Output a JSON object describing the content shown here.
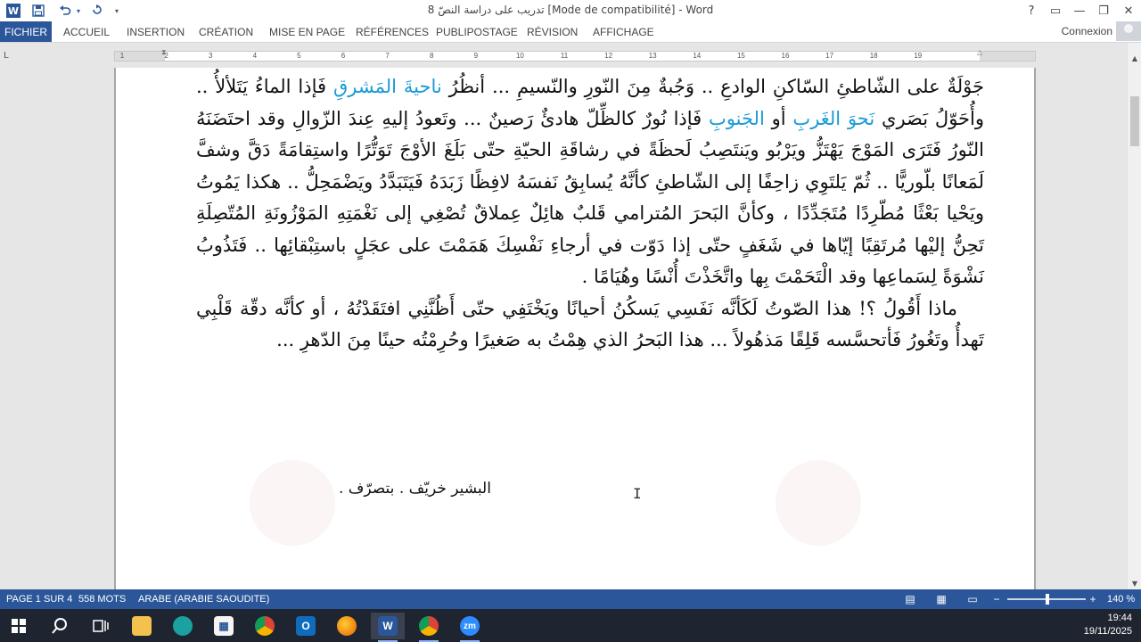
{
  "window": {
    "title": "تدريب على دراسة النصّ 8 [Mode de compatibilité] - Word"
  },
  "quick_access": {
    "word_icon": "W",
    "save_icon": "floppy-disk",
    "undo_icon": "undo-arrow",
    "redo_icon": "redo-arrow",
    "customize_icon": "dropdown-caret"
  },
  "window_controls": {
    "help": "?",
    "ribbon_display": "▭",
    "minimize": "—",
    "restore": "❐",
    "close": "✕"
  },
  "ribbon": {
    "tabs": [
      "FICHIER",
      "ACCUEIL",
      "INSERTION",
      "CRÉATION",
      "MISE EN PAGE",
      "RÉFÉRENCES",
      "PUBLIPOSTAGE",
      "RÉVISION",
      "AFFICHAGE"
    ],
    "account": "Connexion"
  },
  "ruler": {
    "corner": "L",
    "ticks": [
      "1",
      "2",
      "3",
      "4",
      "5",
      "6",
      "7",
      "8",
      "9",
      "10",
      "11",
      "12",
      "13",
      "14",
      "15",
      "16",
      "17",
      "18",
      "19"
    ]
  },
  "document": {
    "paragraphs": [
      [
        {
          "t": "جَوْلَةٌ على الشّاطئِ السّاكنِ الوادعِ .. وَجُبةٌ مِنَ النّورِ والنّسيمِ ... أنظُرُ ",
          "hl": false
        },
        {
          "t": "ناحيةَ المَشرقِ",
          "hl": true
        },
        {
          "t": " فَإذا الماءُ يَتَلألأُ .. وأُحَوّلُ بَصَري ",
          "hl": false
        },
        {
          "t": "نَحوَ الغَربِ",
          "hl": true
        },
        {
          "t": " أو ",
          "hl": false
        },
        {
          "t": "الجَنوبِ",
          "hl": true
        },
        {
          "t": " فَإذا نُورٌ كالظِّلّ هادئٌ رَصينٌ ... وتَعودُ إليهِ عِندَ الزّوالِ وقد احتَضَنَهُ النّورُ فَتَرَى المَوْجَ يَهْتَزُّ ويَرْبُو ويَنتَصِبُ لَحظَةً في رشاقَةِ الحيّةِ حتّى بَلَغَ الأوْجَ تَوَتُّرًا واستِقامَةً دَقَّ وشفَّ لَمَعانًا بلّوريًّا .. ثُمّ يَلتَوِي زاحِفًا إلى الشّاطئِ كأنَّهُ يُسابِقُ نَفسَهُ لافِظًا زَبَدَهُ فَيَتَبَدَّدُ ويَضْمَحِلُّ .. هكذا يَمُوتُ ويَحْيا بَعْثًا مُطّرِدًا مُتَجَدِّدًا ، وكأنَّ البَحرَ المُترامي قَلبٌ هائِلٌ عِملاقٌ تُصْغِي إلى نَغْمَتِهِ المَوْزُونَةِ المُتّصِلَةِ تَحِنُّ إليْها مُرتَقِبًا إيّاها في شَغَفٍ حتّى إذا دَوّت في أرجاءِ نَفْسِكَ هَمَمْتَ على عجَلٍ باستِبْقائِها .. فَتَذُوبُ نَشْوَةً لِسَماعِها وقد الْتَحَمْتَ بِها واتَّخَذْتَ أُنْسًا وهُيَامًا .",
          "hl": false
        }
      ],
      [
        {
          "t": "ماذا أَقُولُ ؟! هذا الصّوتُ لَكَأنَّه نَفَسِي يَسكُنُ أحيانًا ويَخْتَفِي حتّى أَظُنَّنِي افتَقَدْتُهُ ، أو كأنَّه دقّة قَلْبِي تَهدأُ وتَغُورُ فَأتحسَّسه قَلِقًا مَذهُولاً ... هذا البَحرُ الذي هِمْتُ به صَغيرًا وحُرِمْتُه حينًا مِنَ الدّهرِ ...",
          "hl": false
        }
      ]
    ],
    "signature": "البشير خريّف . بتصرّف ."
  },
  "status": {
    "page": "PAGE 1 SUR 4",
    "words": "558 MOTS",
    "language": "ARABE (ARABIE SAOUDITE)",
    "zoom_minus": "−",
    "zoom_plus": "+",
    "zoom": "140 %",
    "zoom_level_fraction": 0.54
  },
  "taskbar": {
    "apps": [
      "start-button",
      "search",
      "task-view",
      "file-explorer",
      "edge",
      "store",
      "chrome",
      "outlook",
      "firefox",
      "word",
      "chrome-2",
      "zoom"
    ],
    "word_label": "W",
    "zoom_label": "zm",
    "time": "19:44",
    "date": "19/11/2025"
  },
  "colors": {
    "accent": "#2b579a",
    "highlight_text": "#1a9ad6",
    "taskbar": "#1f2530"
  }
}
